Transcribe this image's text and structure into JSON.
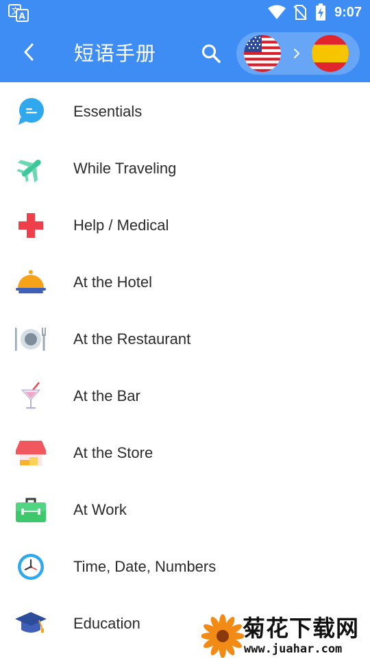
{
  "status_bar": {
    "time": "9:07",
    "icons": [
      "translate-app-icon",
      "wifi-icon",
      "no-sim-icon",
      "battery-charging-icon"
    ]
  },
  "header": {
    "title": "短语手册",
    "background_color": "#3d8df5",
    "back_icon": "back-arrow-icon",
    "search_icon": "search-icon",
    "source_language_flag": "us-flag-icon",
    "target_language_flag": "spain-flag-icon",
    "switch_icon": "chevron-right-icon"
  },
  "categories": [
    {
      "label": "Essentials",
      "icon": "chat-bubble-icon"
    },
    {
      "label": "While Traveling",
      "icon": "airplane-icon"
    },
    {
      "label": "Help / Medical",
      "icon": "medical-cross-icon"
    },
    {
      "label": "At the Hotel",
      "icon": "service-bell-icon"
    },
    {
      "label": "At the Restaurant",
      "icon": "plate-cutlery-icon"
    },
    {
      "label": "At the Bar",
      "icon": "cocktail-icon"
    },
    {
      "label": "At the Store",
      "icon": "store-icon"
    },
    {
      "label": "At Work",
      "icon": "briefcase-icon"
    },
    {
      "label": "Time, Date, Numbers",
      "icon": "clock-icon"
    },
    {
      "label": "Education",
      "icon": "graduation-cap-icon"
    }
  ],
  "watermark": {
    "title": "菊花下载网",
    "url": "www.juahar.com"
  }
}
